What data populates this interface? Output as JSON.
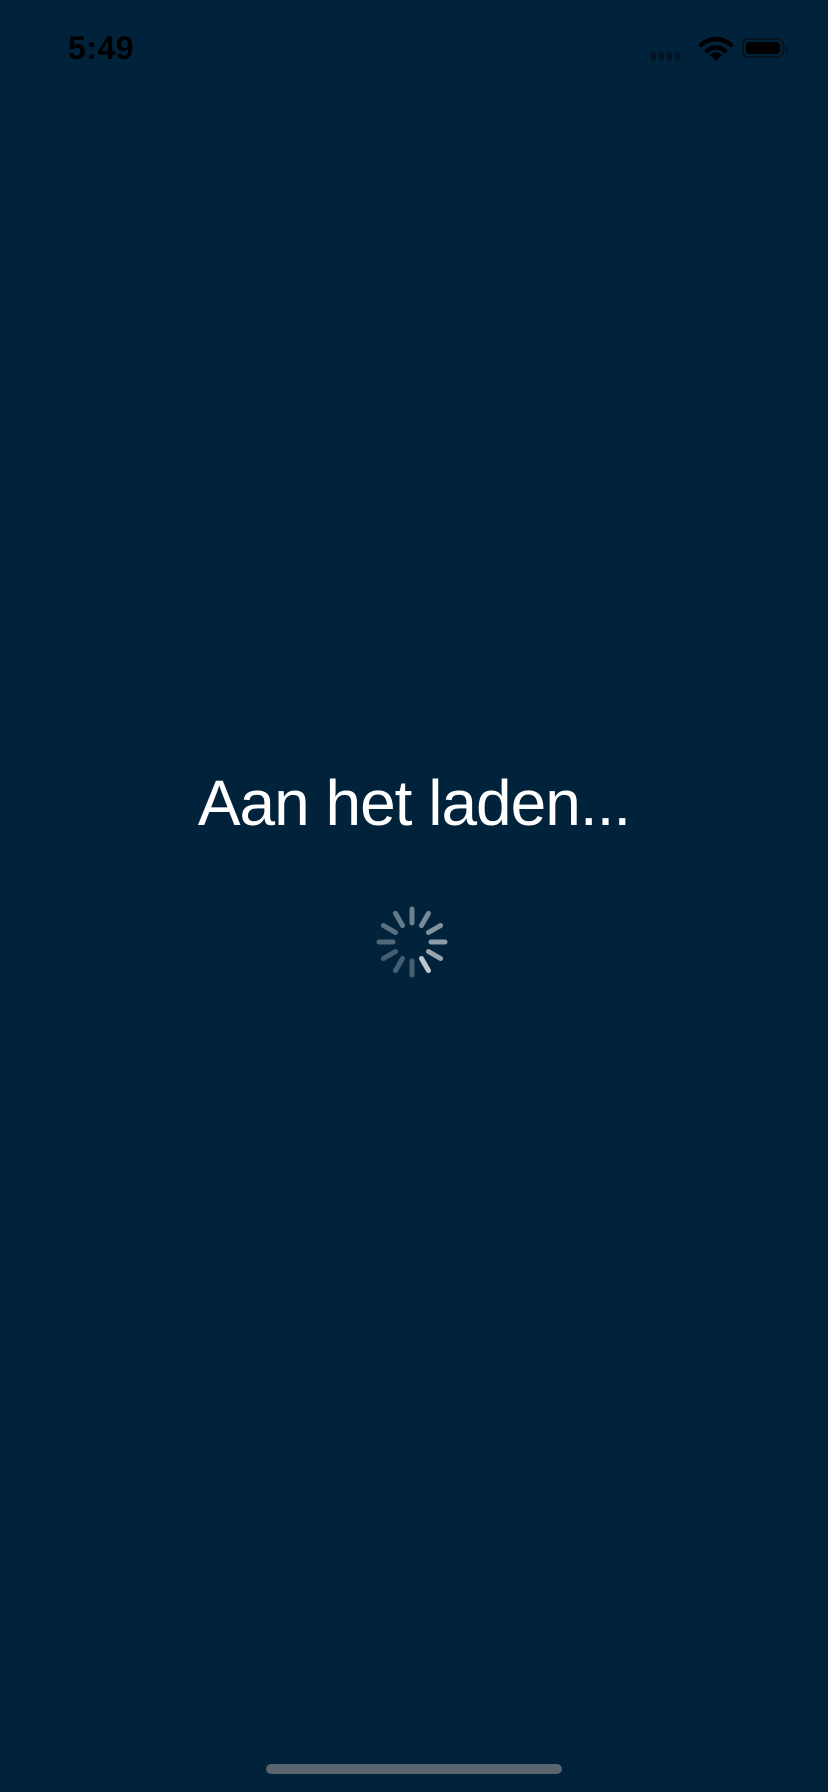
{
  "status_bar": {
    "time": "5:49",
    "icons": [
      "cellular-signal-icon",
      "wifi-icon",
      "battery-icon"
    ]
  },
  "main": {
    "loading_text": "Aan het laden...",
    "spinner": "activity-indicator-icon"
  },
  "colors": {
    "background": "#00223a",
    "text": "#ffffff",
    "spinner": "#c8d0d6"
  }
}
